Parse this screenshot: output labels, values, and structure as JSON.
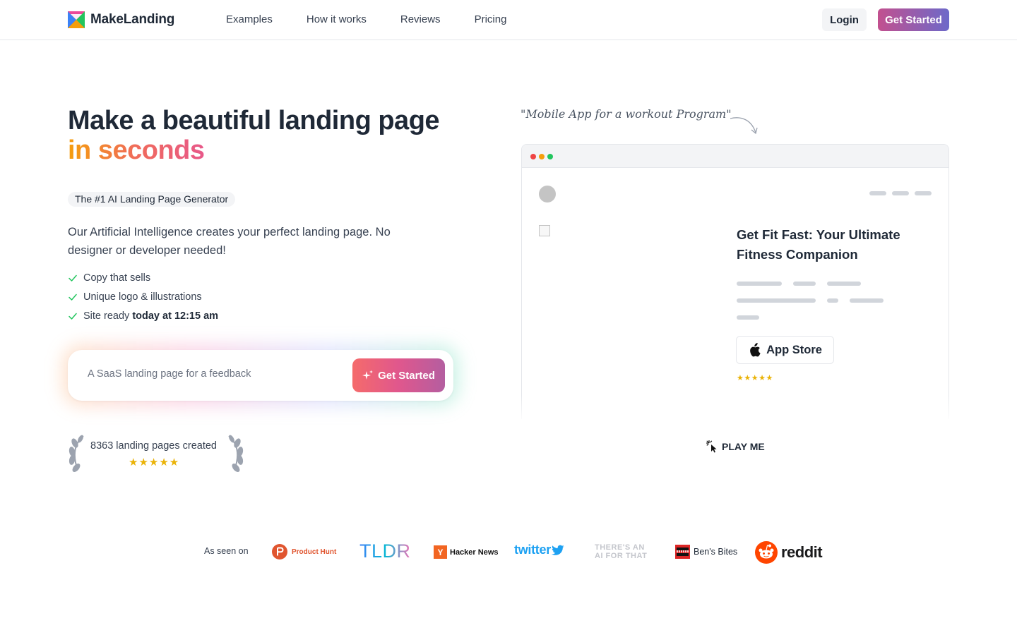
{
  "nav": {
    "brand": "MakeLanding",
    "links": [
      "Examples",
      "How it works",
      "Reviews",
      "Pricing"
    ],
    "login": "Login",
    "get_started": "Get Started"
  },
  "hero": {
    "title_line1": "Make a beautiful landing page",
    "title_line2": "in seconds",
    "badge": "The #1 AI Landing Page Generator",
    "description": "Our Artificial Intelligence creates your perfect landing page. No designer or developer needed!",
    "features": [
      {
        "text": "Copy that sells",
        "bold": ""
      },
      {
        "text": "Unique logo & illustrations",
        "bold": ""
      },
      {
        "text": "Site ready ",
        "bold": "today at 12:15 am"
      }
    ],
    "prompt_placeholder": "A SaaS landing page for a feedback",
    "prompt_button": "Get Started",
    "award_text": "8363 landing pages created",
    "award_stars": "★★★★★"
  },
  "preview": {
    "handnote": "\"Mobile App for a workout Program\"",
    "title": "Get Fit Fast: Your Ultimate Fitness Companion",
    "store_button": "App Store",
    "stars": "★★★★★",
    "play": "PLAY ME"
  },
  "seen_on": {
    "label": "As seen on",
    "brands": {
      "product_hunt": "Product Hunt",
      "tldr": "TLDR",
      "hacker_news": "Hacker News",
      "twitter": "twitter",
      "theres_an_ai_line1": "THERE'S AN",
      "theres_an_ai_line2": "AI FOR THAT",
      "bens_bites": "Ben's Bites",
      "reddit": "reddit"
    }
  },
  "colors": {
    "accent_gradient_start": "#c2508f",
    "accent_gradient_end": "#6d69c9",
    "check": "#22c55e",
    "star": "#eab308"
  }
}
